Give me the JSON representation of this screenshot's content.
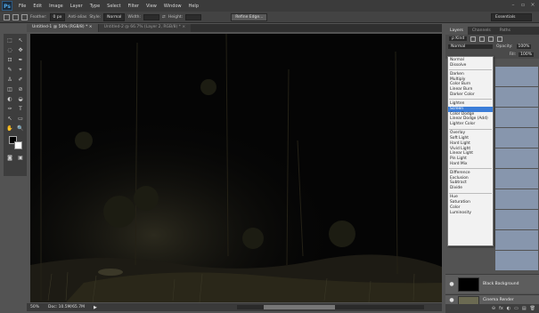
{
  "app": {
    "logo": "Ps"
  },
  "menu": [
    "File",
    "Edit",
    "Image",
    "Layer",
    "Type",
    "Select",
    "Filter",
    "View",
    "Window",
    "Help"
  ],
  "options_bar": {
    "feather_label": "Feather:",
    "feather_value": "0 px",
    "antialias_label": "Anti-alias",
    "style_label": "Style:",
    "style_value": "Normal",
    "width_label": "Width:",
    "height_label": "Height:",
    "refine_edge": "Refine Edge...",
    "workspace": "Essentials"
  },
  "tabs": [
    {
      "label": "Untitled-1 @ 50% (RGB/8) *  ×",
      "active": true
    },
    {
      "label": "Untitled-2 @ 66.7% (Layer 2, RGB/8) *  ×",
      "active": false
    }
  ],
  "tools": [
    "⬚",
    "↖",
    "◌",
    "✥",
    "⊡",
    "✒",
    "✎",
    "⌖",
    "♙",
    "✐",
    "◫",
    "⊘",
    "◐",
    "◒",
    "✑",
    "T",
    "↖",
    "▭",
    "✋",
    "🔍"
  ],
  "status": {
    "zoom": "50%",
    "doc": "Doc: 10.5M/65.7M",
    "arrow": "▶"
  },
  "layers_panel": {
    "tabs": [
      "Layers",
      "Channels",
      "Paths"
    ],
    "kind": "ρ Kind",
    "blend_mode": "Normal",
    "opacity_label": "Opacity:",
    "opacity_value": "100%",
    "fill_label": "Fill:",
    "fill_value": "100%",
    "layers": [
      {
        "name": "Black Background",
        "thumb_color": "#000000"
      },
      {
        "name": "Cinema Render",
        "thumb_color": "#6b6a52"
      }
    ],
    "eye_icon": "●",
    "bottom_icons": [
      "⊖",
      "fx",
      "◐",
      "▭",
      "▤",
      "🗑"
    ]
  },
  "blend_dropdown": {
    "groups": [
      [
        "Normal",
        "Dissolve"
      ],
      [
        "Darken",
        "Multiply",
        "Color Burn",
        "Linear Burn",
        "Darker Color"
      ],
      [
        "Lighten",
        "Screen",
        "Color Dodge",
        "Linear Dodge (Add)",
        "Lighter Color"
      ],
      [
        "Overlay",
        "Soft Light",
        "Hard Light",
        "Vivid Light",
        "Linear Light",
        "Pin Light",
        "Hard Mix"
      ],
      [
        "Difference",
        "Exclusion",
        "Subtract",
        "Divide"
      ],
      [
        "Hue",
        "Saturation",
        "Color",
        "Luminosity"
      ]
    ],
    "selected": "Screen"
  },
  "colors": {
    "canvas": "#050505",
    "panel_blue": "#8796ad",
    "selection": "#3b7dd8"
  }
}
